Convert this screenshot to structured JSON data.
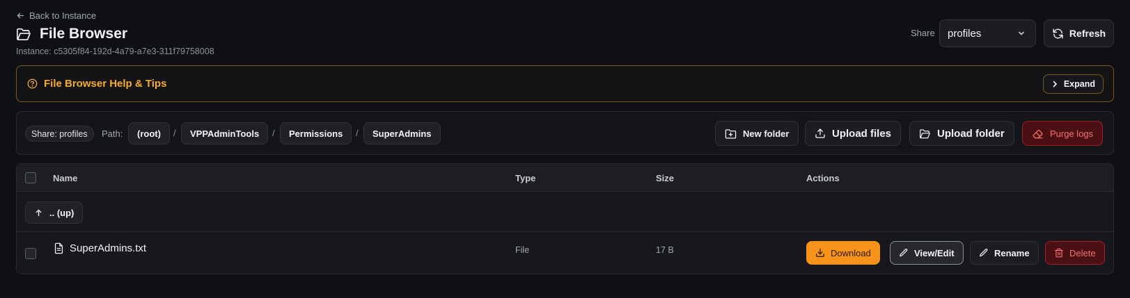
{
  "header": {
    "back_label": "Back to Instance",
    "title": "File Browser",
    "instance_label": "Instance: c5305f84-192d-4a79-a7e3-311f79758008",
    "share_label": "Share",
    "share_value": "profiles",
    "refresh_label": "Refresh"
  },
  "help": {
    "title": "File Browser Help & Tips",
    "expand_label": "Expand"
  },
  "toolbar": {
    "share_chip": "Share: profiles",
    "path_label": "Path:",
    "breadcrumbs": [
      "(root)",
      "VPPAdminTools",
      "Permissions",
      "SuperAdmins"
    ],
    "separator": "/",
    "new_folder_label": "New folder",
    "upload_files_label": "Upload files",
    "upload_folder_label": "Upload folder",
    "purge_logs_label": "Purge logs"
  },
  "table": {
    "columns": [
      "Name",
      "Type",
      "Size",
      "Actions"
    ],
    "up_label": ".. (up)",
    "rows": [
      {
        "name": "SuperAdmins.txt",
        "type": "File",
        "size": "17 B",
        "actions": [
          "Download",
          "View/Edit",
          "Rename",
          "Delete"
        ]
      }
    ]
  },
  "colors": {
    "background": "#0f1013",
    "accent": "#f6ad2b",
    "download": "#f7931a",
    "danger": "#f87171"
  }
}
